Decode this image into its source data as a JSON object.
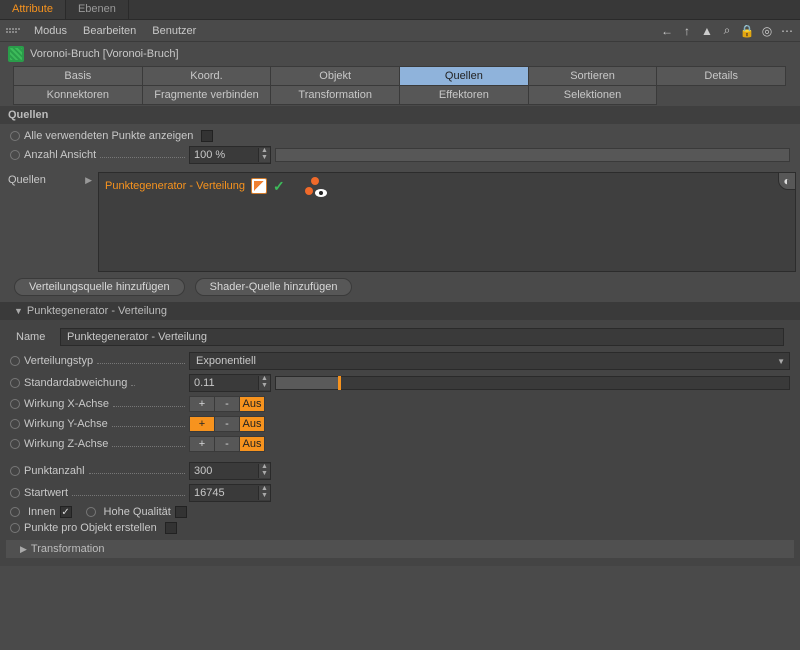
{
  "top_tabs": {
    "attribute": "Attribute",
    "ebenen": "Ebenen"
  },
  "menu": {
    "modus": "Modus",
    "bearbeiten": "Bearbeiten",
    "benutzer": "Benutzer"
  },
  "object": {
    "title": "Voronoi-Bruch [Voronoi-Bruch]"
  },
  "tabs": {
    "basis": "Basis",
    "koord": "Koord.",
    "objekt": "Objekt",
    "quellen": "Quellen",
    "sortieren": "Sortieren",
    "details": "Details",
    "konnektoren": "Konnektoren",
    "fragmente": "Fragmente verbinden",
    "transformation": "Transformation",
    "effektoren": "Effektoren",
    "selektionen": "Selektionen"
  },
  "section": {
    "quellen_hdr": "Quellen",
    "alle_punkte": "Alle verwendeten Punkte anzeigen",
    "anzahl_ansicht": "Anzahl Ansicht",
    "anzahl_ansicht_val": "100 %",
    "quellen_lbl": "Quellen",
    "q_item_name": "Punktegenerator - Verteilung"
  },
  "buttons": {
    "verteilungsquelle": "Verteilungsquelle hinzufügen",
    "shaderquelle": "Shader-Quelle hinzufügen"
  },
  "generator": {
    "header": "Punktegenerator - Verteilung",
    "name_lbl": "Name",
    "name_val": "Punktegenerator - Verteilung",
    "verteilungstyp_lbl": "Verteilungstyp",
    "verteilungstyp_val": "Exponentiell",
    "stdabw_lbl": "Standardabweichung",
    "stdabw_val": "0.11",
    "wirkung_x": "Wirkung X-Achse",
    "wirkung_y": "Wirkung Y-Achse",
    "wirkung_z": "Wirkung Z-Achse",
    "plus": "+",
    "minus": "-",
    "aus": "Aus",
    "punktanzahl_lbl": "Punktanzahl",
    "punktanzahl_val": "300",
    "startwert_lbl": "Startwert",
    "startwert_val": "16745",
    "innen": "Innen",
    "hohe_qualitaet": "Hohe Qualität",
    "punkte_pro_objekt": "Punkte pro Objekt erstellen",
    "transformation": "Transformation"
  }
}
